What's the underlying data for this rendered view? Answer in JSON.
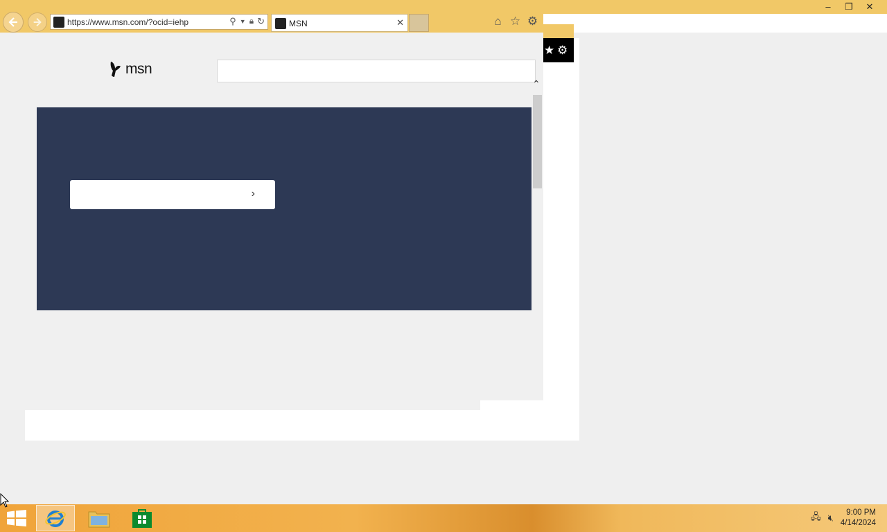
{
  "browser": {
    "url": "https://www.msn.com/?ocid=iehp",
    "tab_title": "MSN",
    "tab_close": "✕",
    "window_controls": [
      "–",
      "❐",
      "✕"
    ]
  },
  "page": {
    "logo_text": "msn",
    "search_placeholder": "",
    "hero_button_label": "",
    "hero_button_chevron": "›"
  },
  "floating_bar": {
    "icons": [
      "star-icon",
      "gear-icon"
    ]
  },
  "taskbar": {
    "apps": [
      "internet-explorer",
      "file-explorer",
      "store"
    ],
    "time": "9:00 PM",
    "date": "4/14/2024"
  },
  "colors": {
    "titlebar": "#f1c867",
    "hero_background": "#2d3955",
    "taskbar": "#f0a43a"
  }
}
